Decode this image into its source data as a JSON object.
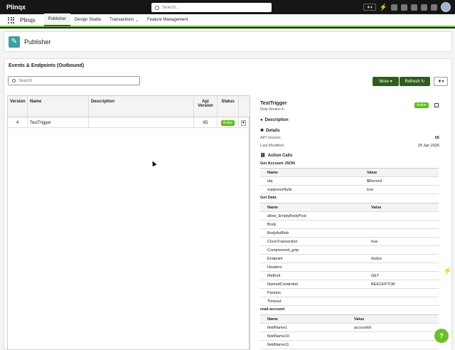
{
  "topbar": {
    "logo": "Plinqx",
    "search_placeholder": "Search...",
    "star_label": "★▾"
  },
  "nav": {
    "app_name": "Plinqx",
    "items": [
      "Publisher",
      "Design Studio",
      "Transactions",
      "Feature Management"
    ],
    "active": "Publisher"
  },
  "page": {
    "title": "Publisher",
    "card_title": "Events & Endpoints (Outbound)",
    "search_placeholder": "Search"
  },
  "buttons": {
    "more": "More",
    "refresh": "Refresh"
  },
  "table": {
    "columns": [
      "Version",
      "Name",
      "Description",
      "Api Version",
      "Status"
    ],
    "rows": [
      {
        "version": "4",
        "name": "TestTrigger",
        "description": "",
        "api_version": "65",
        "status": "Active"
      }
    ]
  },
  "detail": {
    "title": "TestTrigger",
    "subtitle": "Flow Version 4",
    "status": "Active",
    "description_label": "Description",
    "details_label": "Details",
    "api_version_label": "API Version",
    "api_version": "65",
    "last_modified_label": "Last Modified",
    "last_modified": "29 Jan 2026",
    "action_calls_label": "Action Calls",
    "groups": [
      {
        "title": "Get Account JSON",
        "headers": [
          "Name",
          "Value"
        ],
        "rows": [
          [
            "obj",
            "$Record"
          ],
          [
            "suppressNulls",
            "true"
          ]
        ]
      },
      {
        "title": "Get Data",
        "headers": [
          "Name",
          "Value"
        ],
        "rows": [
          [
            "allow_EmptyBodyPost",
            ""
          ],
          [
            "Body",
            ""
          ],
          [
            "BodyAsBlob",
            ""
          ],
          [
            "CloseTransaction",
            "true"
          ],
          [
            "Compressed_gzip",
            ""
          ],
          [
            "Endpoint",
            "/todos"
          ],
          [
            "Headers",
            ""
          ],
          [
            "Method",
            "GET"
          ],
          [
            "NamedCredential",
            "BEECEPTOR"
          ],
          [
            "Params",
            ""
          ],
          [
            "Timeout",
            ""
          ]
        ]
      },
      {
        "title": "read account",
        "headers": [
          "Name",
          "Value"
        ],
        "rows": [
          [
            "fieldName1",
            "accountId"
          ],
          [
            "fieldName10",
            ""
          ],
          [
            "fieldName11",
            ""
          ]
        ]
      }
    ]
  },
  "help_label": "?",
  "colors": {
    "accent_green": "#5bc10e",
    "button_green": "#2e5e1a",
    "nav_underline": "#7ed321",
    "header_icon": "#3aa0a0"
  }
}
